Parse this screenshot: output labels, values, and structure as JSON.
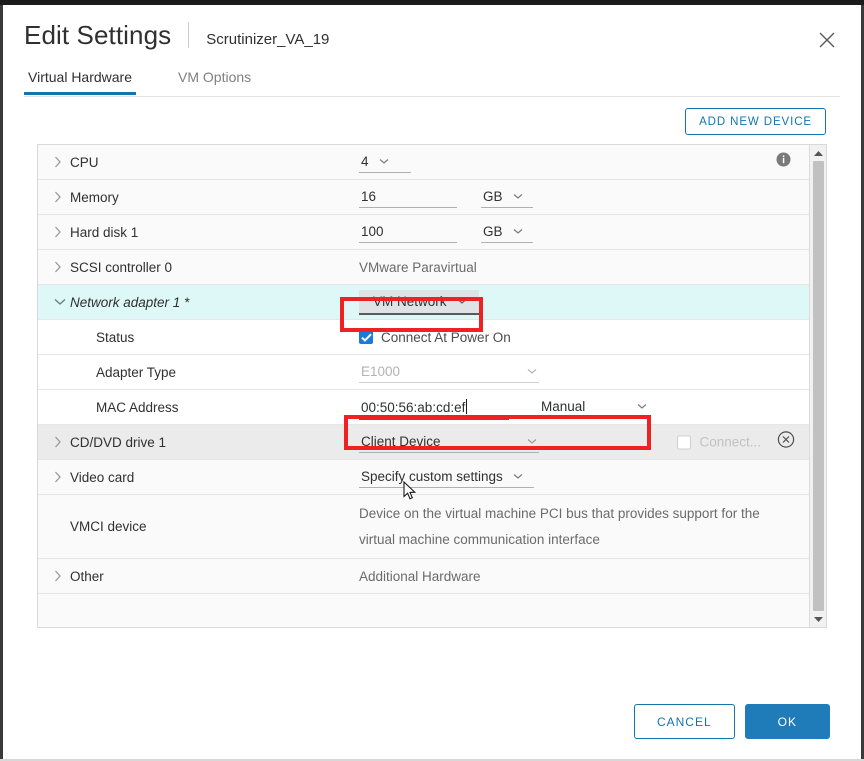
{
  "window": {
    "title": "Edit Settings",
    "subtitle": "Scrutinizer_VA_19",
    "close_icon": "close-icon"
  },
  "tabs": [
    {
      "label": "Virtual Hardware",
      "active": true
    },
    {
      "label": "VM Options",
      "active": false
    }
  ],
  "toolbar": {
    "add_new_device_label": "ADD NEW DEVICE"
  },
  "devices": {
    "cpu": {
      "label": "CPU",
      "value": "4",
      "info_icon": "info-icon"
    },
    "memory": {
      "label": "Memory",
      "value": "16",
      "unit": "GB"
    },
    "hard_disk": {
      "label": "Hard disk 1",
      "value": "100",
      "unit": "GB"
    },
    "scsi": {
      "label": "SCSI controller 0",
      "value": "VMware Paravirtual"
    },
    "network_adapter": {
      "label": "Network adapter 1 *",
      "network": "VM Network",
      "status_label": "Status",
      "status_checkbox_label": "Connect At Power On",
      "status_checked": true,
      "adapter_type_label": "Adapter Type",
      "adapter_type_value": "E1000",
      "mac_label": "MAC Address",
      "mac_value": "00:50:56:ab:cd:ef",
      "mac_mode": "Manual"
    },
    "cddvd": {
      "label": "CD/DVD drive 1",
      "value": "Client Device",
      "connect_label": "Connect...",
      "connect_checked": false,
      "remove_icon": "remove-device-icon"
    },
    "video_card": {
      "label": "Video card",
      "value": "Specify custom settings"
    },
    "vmci": {
      "label": "VMCI device",
      "description": "Device on the virtual machine PCI bus that provides support for the virtual machine communication interface"
    },
    "other": {
      "label": "Other",
      "value": "Additional Hardware"
    }
  },
  "scrollbar": {
    "up_icon": "scroll-up-arrow-icon",
    "down_icon": "scroll-down-arrow-icon"
  },
  "footer": {
    "cancel_label": "CANCEL",
    "ok_label": "OK"
  },
  "annotations": {
    "network_highlight": "red-box-network-dropdown",
    "mac_highlight": "red-box-mac-address"
  },
  "colors": {
    "accent_blue": "#1276ad",
    "ok_button": "#1f7cb8",
    "annotation_red": "#ee2222",
    "highlight_row": "#ddf8f7"
  }
}
